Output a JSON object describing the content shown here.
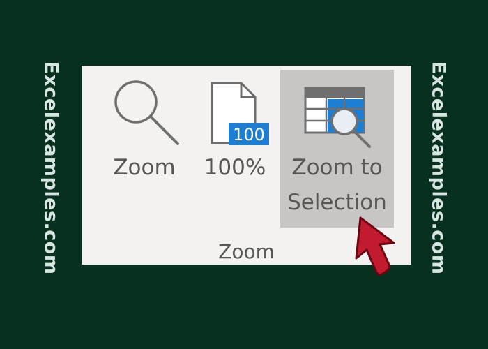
{
  "watermark": {
    "left": "Excelexamples.com",
    "right": "Excelexamples.com"
  },
  "ribbon": {
    "group_label": "Zoom",
    "buttons": [
      {
        "label": "Zoom",
        "icon": "magnifier-icon"
      },
      {
        "label": "100%",
        "icon": "page-100-icon",
        "badge": "100"
      },
      {
        "label_line1": "Zoom to",
        "label_line2": "Selection",
        "icon": "zoom-to-selection-icon",
        "state": "hovered"
      }
    ]
  },
  "colors": {
    "background": "#08301e",
    "ribbon": "#f3f2f1",
    "hover": "#c8c6c4",
    "text": "#585858",
    "accent_blue": "#1e7fd2",
    "cursor_red": "#c21b2f"
  }
}
